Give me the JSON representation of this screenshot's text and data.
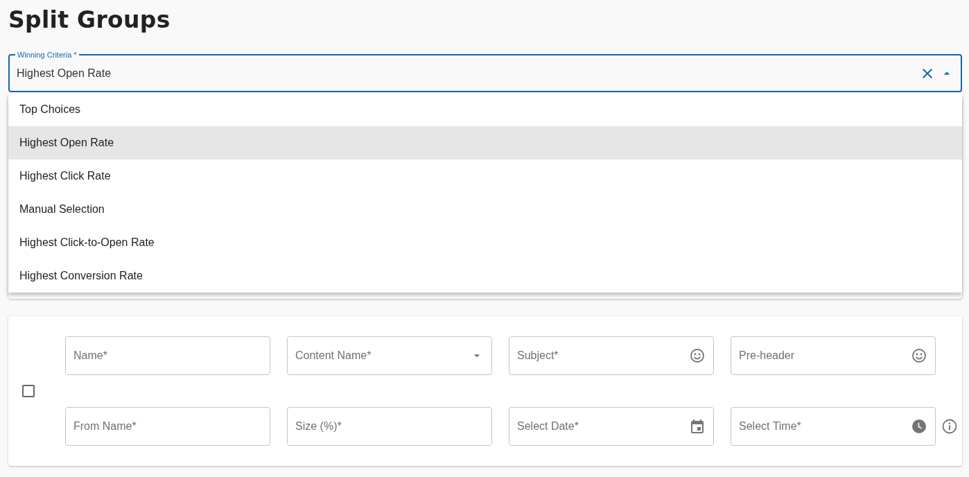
{
  "title": "Split Groups",
  "winning_criteria": {
    "label": "Winning Criteria *",
    "value": "Highest Open Rate",
    "expanded": true,
    "options": [
      {
        "label": "Top Choices",
        "selected": false
      },
      {
        "label": "Highest Open Rate",
        "selected": true
      },
      {
        "label": "Highest Click Rate",
        "selected": false
      },
      {
        "label": "Manual Selection",
        "selected": false
      },
      {
        "label": "Highest Click-to-Open Rate",
        "selected": false
      },
      {
        "label": "Highest Conversion Rate",
        "selected": false
      }
    ]
  },
  "split_group": {
    "checked": false,
    "fields": [
      {
        "placeholder": "Name*",
        "kind": "text"
      },
      {
        "placeholder": "Content Name*",
        "kind": "select"
      },
      {
        "placeholder": "Subject*",
        "kind": "emoji"
      },
      {
        "placeholder": "Pre-header",
        "kind": "emoji"
      },
      {
        "placeholder": "From Name*",
        "kind": "text"
      },
      {
        "placeholder": "Size (%)*",
        "kind": "text"
      },
      {
        "placeholder": "Select Date*",
        "kind": "date"
      },
      {
        "placeholder": "Select Time*",
        "kind": "time"
      }
    ]
  }
}
